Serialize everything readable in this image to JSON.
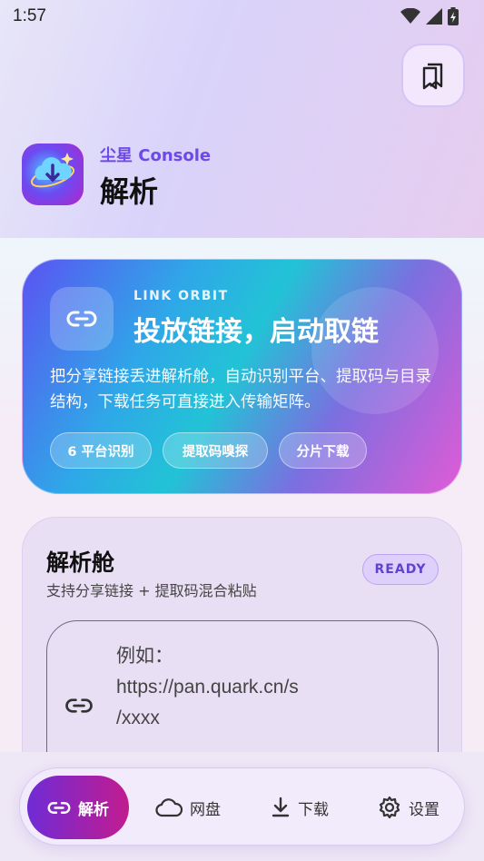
{
  "status_bar": {
    "time": "1:57"
  },
  "header": {
    "brand_label": "尘星 Console",
    "page_title": "解析"
  },
  "hero": {
    "eyebrow": "LINK ORBIT",
    "title": "投放链接，启动取链",
    "description": "把分享链接丢进解析舱，自动识别平台、提取码与目录结构，下载任务可直接进入传输矩阵。",
    "chips": [
      "6 平台识别",
      "提取码嗅探",
      "分片下载"
    ]
  },
  "parse_card": {
    "title": "解析舱",
    "subtitle": "支持分享链接 + 提取码混合粘贴",
    "badge": "READY",
    "input_placeholder": "例如：\nhttps://pan.quark.cn/s\n/xxxx"
  },
  "bottom_nav": {
    "items": [
      {
        "label": "解析",
        "icon": "link-icon",
        "active": true
      },
      {
        "label": "网盘",
        "icon": "cloud-icon",
        "active": false
      },
      {
        "label": "下载",
        "icon": "download-icon",
        "active": false
      },
      {
        "label": "设置",
        "icon": "gear-icon",
        "active": false
      }
    ]
  },
  "colors": {
    "accent": "#6d49e8",
    "nav_active_start": "#6f2bd6",
    "nav_active_end": "#c21c8f"
  }
}
